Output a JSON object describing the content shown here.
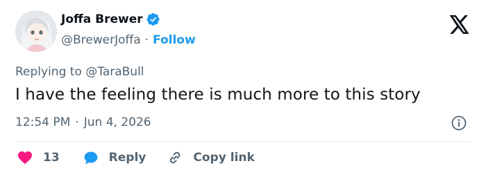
{
  "author": {
    "display_name": "Joffa Brewer",
    "handle": "@BrewerJoffa",
    "separator": "·",
    "follow_label": "Follow",
    "verified": true
  },
  "reply_context": {
    "prefix": "Replying to",
    "mention": "@TaraBull"
  },
  "tweet": {
    "text": "I have the feeling there is much more to this story",
    "time": "12:54 PM",
    "date_separator": "·",
    "date": "Jun 4, 2026"
  },
  "actions": {
    "like_count": "13",
    "reply_label": "Reply",
    "copy_link_label": "Copy link"
  },
  "colors": {
    "accent": "#1d9bf0",
    "like": "#f91880",
    "secondary_text": "#536471",
    "primary_text": "#0f1419"
  },
  "icons": {
    "verified": "verified-badge-icon",
    "brand": "x-logo-icon",
    "info": "info-icon",
    "like": "heart-icon",
    "reply": "speech-bubble-icon",
    "copy_link": "link-icon"
  }
}
